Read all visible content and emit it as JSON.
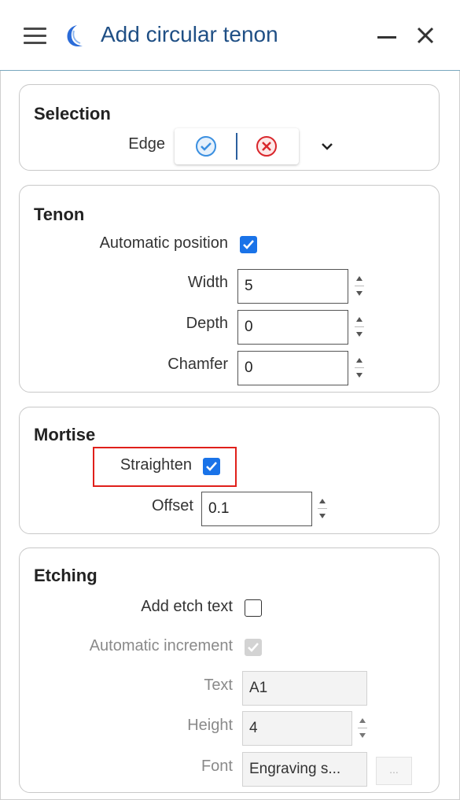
{
  "window": {
    "title": "Add circular tenon",
    "icons": {
      "menu": "hamburger-icon",
      "app": "crescent-app-icon",
      "minimize": "minimize-icon",
      "close": "close-icon"
    }
  },
  "selection": {
    "title": "Selection",
    "edge_label": "Edge",
    "accept_icon": "check-circle-icon",
    "cancel_icon": "x-circle-icon",
    "expand_icon": "chevron-down-icon"
  },
  "tenon": {
    "title": "Tenon",
    "automatic_position_label": "Automatic position",
    "automatic_position_checked": true,
    "width_label": "Width",
    "width_value": "5",
    "depth_label": "Depth",
    "depth_value": "0",
    "chamfer_label": "Chamfer",
    "chamfer_value": "0"
  },
  "mortise": {
    "title": "Mortise",
    "straighten_label": "Straighten",
    "straighten_checked": true,
    "offset_label": "Offset",
    "offset_value": "0.1"
  },
  "etching": {
    "title": "Etching",
    "add_etch_text_label": "Add etch text",
    "add_etch_text_checked": false,
    "automatic_increment_label": "Automatic increment",
    "automatic_increment_checked": true,
    "text_label": "Text",
    "text_value": "A1",
    "height_label": "Height",
    "height_value": "4",
    "font_label": "Font",
    "font_value": "Engraving s...",
    "font_browse_label": "..."
  },
  "colors": {
    "accent": "#1a73e8",
    "title": "#1f4f85",
    "highlight": "#e0201b",
    "accept": "#3a8fe0",
    "cancel": "#d9262b"
  }
}
